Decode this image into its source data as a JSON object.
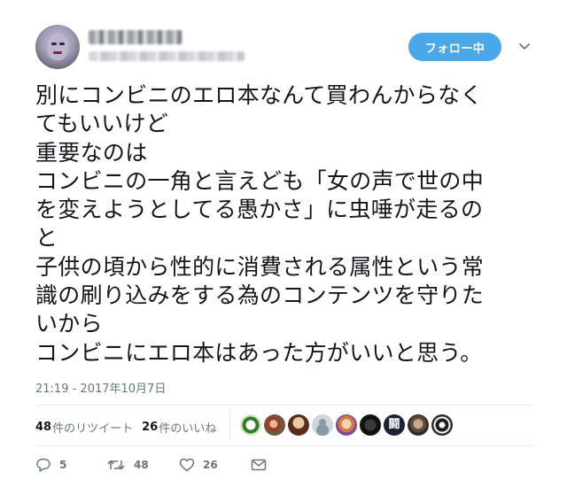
{
  "user": {
    "display_name": "",
    "screen_name": ""
  },
  "follow_button": "フォロー中",
  "tweet": {
    "text": "別にコンビニのエロ本なんて買わんからなく\nてもいいけど\n重要なのは\nコンビニの一角と言えども「女の声で世の中\nを変えようとしてる愚かさ」に虫唾が走るの\nと\n子供の頃から性的に消費される属性という常\n識の刷り込みをする為のコンテンツを守りた\nいから\nコンビニにエロ本はあった方がいいと思う。",
    "timestamp": "21:19 - 2017年10月7日"
  },
  "stats": {
    "retweets_count": "48",
    "retweets_label": "件のリツイート",
    "likes_count": "26",
    "likes_label": "件のいいね"
  },
  "likers": {
    "icons": [
      "liker-avatar-1",
      "liker-avatar-2",
      "liker-avatar-3",
      "liker-avatar-4",
      "liker-avatar-5",
      "liker-avatar-6",
      "liker-avatar-7",
      "liker-avatar-8",
      "liker-avatar-9"
    ],
    "avatar7_glyph": "闘"
  },
  "actions": {
    "reply_count": "5",
    "retweet_count": "48",
    "like_count": "26"
  },
  "colors": {
    "accent": "#4aa7e8",
    "text": "#14171a",
    "muted": "#657786",
    "divider": "#e6ecf0"
  }
}
